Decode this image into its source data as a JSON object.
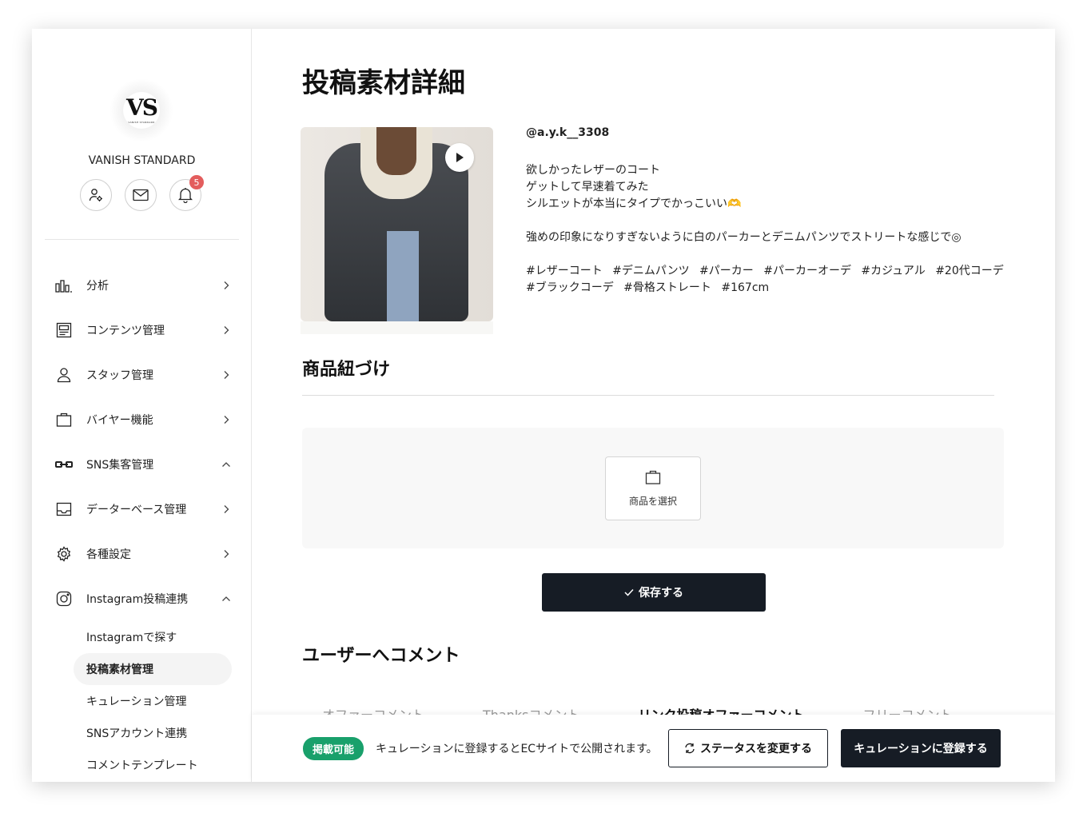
{
  "sidebar": {
    "logo_mark": "VS",
    "logo_sub": "VANISH STANDARD",
    "shop_name": "VANISH STANDARD",
    "notification_count": "5",
    "menu": [
      {
        "label": "分析",
        "icon": "bar-chart-icon",
        "expanded": false
      },
      {
        "label": "コンテンツ管理",
        "icon": "content-icon",
        "expanded": false
      },
      {
        "label": "スタッフ管理",
        "icon": "user-icon",
        "expanded": false
      },
      {
        "label": "バイヤー機能",
        "icon": "bag-icon",
        "expanded": false
      },
      {
        "label": "SNS集客管理",
        "icon": "link-icon",
        "expanded": true
      },
      {
        "label": "データーベース管理",
        "icon": "inbox-icon",
        "expanded": false
      },
      {
        "label": "各種設定",
        "icon": "gear-icon",
        "expanded": false
      },
      {
        "label": "Instagram投稿連携",
        "icon": "instagram-icon",
        "expanded": true
      }
    ],
    "submenu": [
      {
        "label": "Instagramで探す",
        "active": false
      },
      {
        "label": "投稿素材管理",
        "active": true
      },
      {
        "label": "キュレーション管理",
        "active": false
      },
      {
        "label": "SNSアカウント連携",
        "active": false
      },
      {
        "label": "コメントテンプレート",
        "active": false
      }
    ]
  },
  "main": {
    "title": "投稿素材詳細",
    "post": {
      "user": "@a.y.k__3308",
      "caption": "欲しかったレザーのコート\nゲットして早速着てみた\nシルエットが本当にタイプでかっこいい🫶\n\n強めの印象になりすぎないように白のパーカーとデニムパンツでストリートな感じで◎",
      "tags": "#レザーコート #デニムパンツ #パーカー #パーカーオーデ #カジュアル #20代コーデ #ブラックコーデ #骨格ストレート #167cm"
    },
    "product_section_title": "商品紐づけ",
    "select_product_label": "商品を選択",
    "save_label": "保存する",
    "comment_section_title": "ユーザーへコメント",
    "tabs": [
      {
        "label": "オファーコメント",
        "active": false
      },
      {
        "label": "Thanksコメント",
        "active": false
      },
      {
        "label": "リンク投稿オファーコメント",
        "active": true
      },
      {
        "label": "フリーコメント",
        "active": false
      }
    ]
  },
  "bottom_bar": {
    "status": "掲載可能",
    "status_color": "#19a06b",
    "note": "キュレーションに登録するとECサイトで公開されます。",
    "change_status_label": "ステータスを変更する",
    "register_label": "キュレーションに登録する"
  }
}
